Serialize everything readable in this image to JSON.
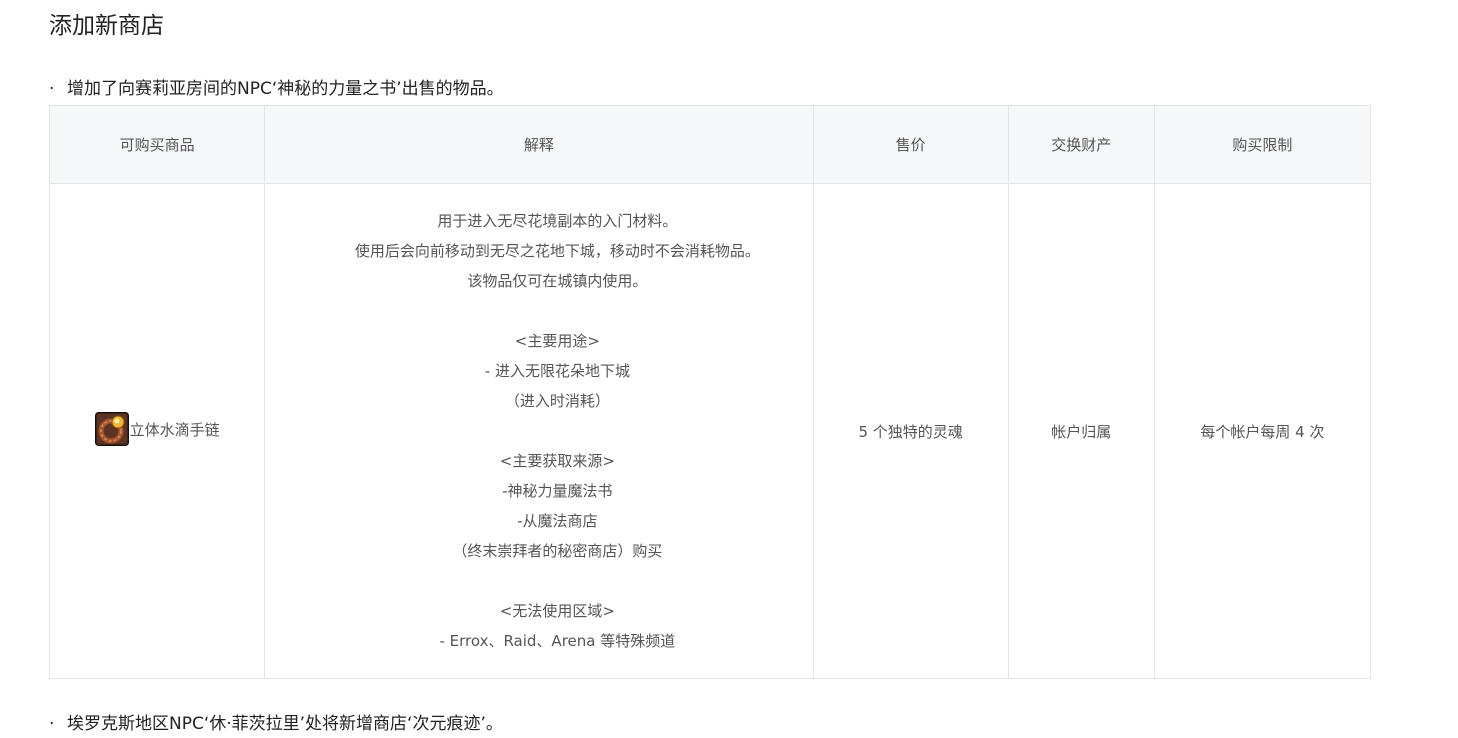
{
  "section_title": "添加新商店",
  "bullet_1": "增加了向赛莉亚房间的NPC‘神秘的力量之书’出售的物品。",
  "bullet_2": "埃罗克斯地区NPC‘休·菲茨拉里’处将新增商店‘次元痕迹’。",
  "bullet_dot": "·",
  "table": {
    "headers": [
      "可购买商品",
      "解释",
      "售价",
      "交换财产",
      "购买限制"
    ],
    "rows": [
      {
        "item_name": "立体水滴手链",
        "item_icon": "bracelet-item-icon",
        "description": "用于进入无尽花境副本的入门材料。\n使用后会向前移动到无尽之花地下城，移动时不会消耗物品。\n该物品仅可在城镇内使用。\n\n<主要用途>\n- 进入无限花朵地下城\n（进入时消耗）\n\n<主要获取来源>\n-神秘力量魔法书\n-从魔法商店\n（终末崇拜者的秘密商店）购买\n\n<无法使用区域>\n- Errox、Raid、Arena 等特殊频道",
        "price": "5 个独特的灵魂",
        "trade": "帐户归属",
        "limit": "每个帐户每周 4 次"
      }
    ]
  },
  "colors": {
    "header_bg": "#f6f7f9",
    "border": "#e1e4e8",
    "text": "#555555",
    "title": "#222222"
  }
}
